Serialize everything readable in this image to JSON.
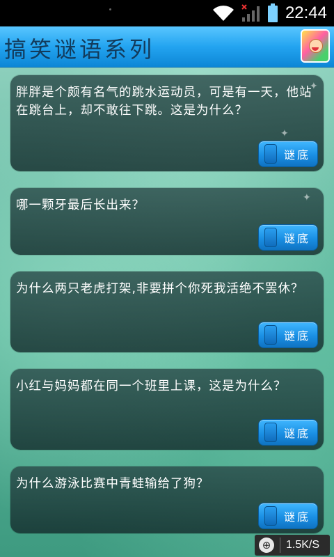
{
  "status_bar": {
    "time": "22:44",
    "icons": [
      "wifi-icon",
      "signal-icon",
      "battery-icon"
    ]
  },
  "header": {
    "title": "搞笑谜语系列",
    "app_icon": "cartoon-app-icon"
  },
  "riddles": [
    {
      "question": "胖胖是个颇有名气的跳水运动员，可是有一天，他站在跳台上，却不敢往下跳。这是为什么？",
      "button_label": "谜底"
    },
    {
      "question": "哪一颗牙最后长出来？",
      "button_label": "谜底"
    },
    {
      "question": "为什么两只老虎打架,非要拼个你死我活绝不罢休？",
      "button_label": "谜底"
    },
    {
      "question": "小红与妈妈都在同一个班里上课，这是为什么？",
      "button_label": "谜底"
    },
    {
      "question": "为什么游泳比赛中青蛙输给了狗？",
      "button_label": "谜底"
    }
  ],
  "speed_indicator": {
    "value": "1.5K/S",
    "icon": "speed-icon"
  },
  "colors": {
    "accent": "#1a8fe4",
    "title_bar": "#23a4f0",
    "card_bg": "#1f3d3d"
  }
}
